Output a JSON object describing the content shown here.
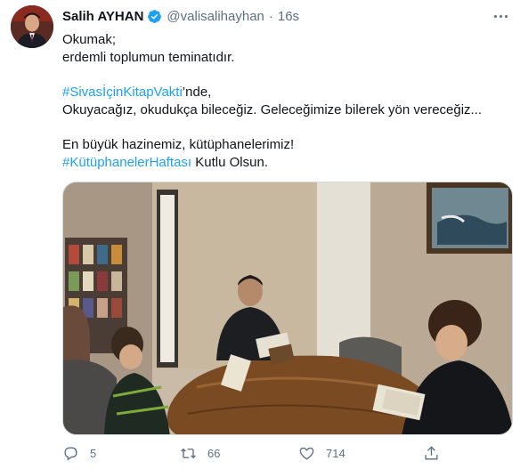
{
  "user": {
    "display_name": "Salih AYHAN",
    "handle": "@valisalihayhan",
    "separator": "·",
    "time": "16s"
  },
  "tweet": {
    "line1": "Okumak;",
    "line2": "erdemli toplumun teminatıdır.",
    "hashtag1": "#SivasİçinKitapVakti",
    "line3_suffix": "’nde,",
    "line4": "Okuyacağız, okudukça bileceğiz. Geleceğimize bilerek yön vereceğiz...",
    "line5": "En büyük hazinemiz, kütüphanelerimiz!",
    "hashtag2": "#KütüphanelerHaftası",
    "line6_suffix": " Kutlu Olsun."
  },
  "actions": {
    "reply_count": "5",
    "retweet_count": "66",
    "like_count": "714"
  },
  "icons": {
    "verified": "verified-badge-icon",
    "more": "more-options-icon",
    "reply": "reply-icon",
    "retweet": "retweet-icon",
    "like": "heart-icon",
    "share": "share-icon"
  },
  "colors": {
    "link": "#1da1f2",
    "muted": "#5b7083",
    "text": "#0f1419"
  }
}
